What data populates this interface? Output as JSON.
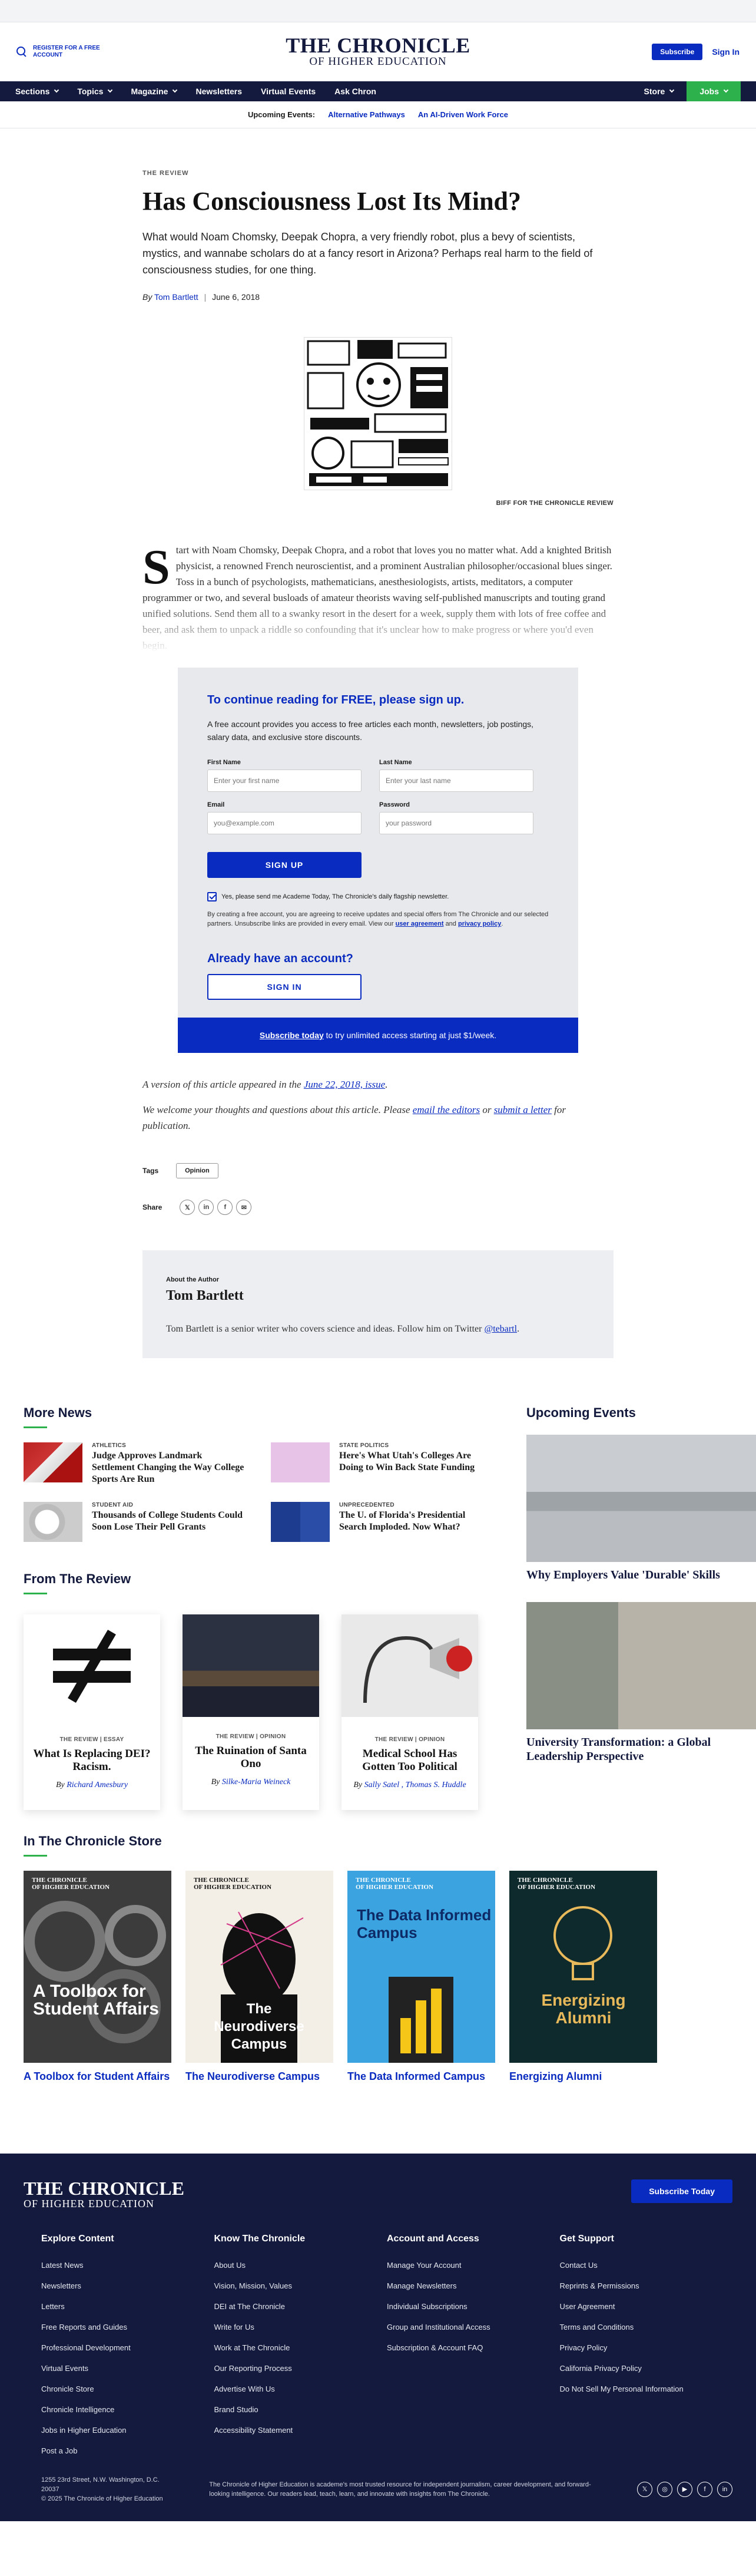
{
  "header": {
    "register": "REGISTER FOR A FREE ACCOUNT",
    "logo_line1": "THE CHRONICLE",
    "logo_line2": "OF HIGHER EDUCATION",
    "subscribe": "Subscribe",
    "signin": "Sign In"
  },
  "nav": {
    "left": [
      "Sections",
      "Topics",
      "Magazine",
      "Newsletters",
      "Virtual Events",
      "Ask Chron"
    ],
    "right": [
      "Store",
      "Jobs"
    ]
  },
  "upcoming": {
    "label": "Upcoming Events:",
    "links": [
      "Alternative Pathways",
      "An AI-Driven Work Force"
    ]
  },
  "article": {
    "kicker": "THE REVIEW",
    "title": "Has Consciousness Lost Its Mind?",
    "dek": "What would Noam Chomsky, Deepak Chopra, a very friendly robot, plus a bevy of scientists, mystics, and wannabe scholars do at a fancy resort in Arizona? Perhaps real harm to the field of consciousness studies, for one thing.",
    "by": "By",
    "author": "Tom Bartlett",
    "date": "June 6, 2018",
    "caption": "BIFF FOR THE CHRONICLE REVIEW",
    "dropcap": "S",
    "body": "tart with Noam Chomsky, Deepak Chopra, and a robot that loves you no matter what. Add a knighted British physicist, a renowned French neuroscientist, and a prominent Australian philosopher/occasional blues singer. Toss in a bunch of psychologists, mathematicians, anesthesiologists, artists, meditators, a computer programmer or two, and several busloads of amateur theorists waving self-published manuscripts and touting grand unified solutions. Send them all to a swanky resort in the desert for a week, supply them with lots of free coffee and beer, and ask them to unpack a riddle so confounding that it's unclear how to make progress or where you'd even begin."
  },
  "paywall": {
    "title": "To continue reading for FREE, please sign up.",
    "text": "A free account provides you access to free articles each month, newsletters, job postings, salary data, and exclusive store discounts.",
    "first_label": "First Name",
    "first_ph": "Enter your first name",
    "last_label": "Last Name",
    "last_ph": "Enter your last name",
    "email_label": "Email",
    "email_ph": "you@example.com",
    "password_label": "Password",
    "password_ph": "your password",
    "signup": "SIGN UP",
    "check_label": "Yes, please send me Academe Today, The Chronicle's daily flagship newsletter.",
    "legal_1": "By creating a free account, you are agreeing to receive updates and special offers from The Chronicle and our selected partners. Unsubscribe links are provided in every email. View our",
    "legal_link1": "user agreement",
    "legal_and": "and",
    "legal_link2": "privacy policy",
    "have_account": "Already have an account?",
    "signin": "SIGN IN",
    "bar_link": "Subscribe today",
    "bar_text": "to try unlimited access starting at just $1/week."
  },
  "after": {
    "version_1": "A version of this article appeared in the",
    "version_link": "June 22, 2018, issue",
    "welcome_1": "We welcome your thoughts and questions about this article. Please",
    "welcome_link1": "email the editors",
    "welcome_or": "or",
    "welcome_link2": "submit a letter",
    "welcome_2": "for publication.",
    "tags_label": "Tags",
    "tag": "Opinion",
    "share_label": "Share",
    "share_icons": [
      "x-icon",
      "linkedin-icon",
      "facebook-icon",
      "email-icon"
    ]
  },
  "author_box": {
    "kicker": "About the Author",
    "name": "Tom Bartlett",
    "bio": "Tom Bartlett is a senior writer who covers science and ideas. Follow him on Twitter",
    "handle": "@tebartl"
  },
  "more_news": {
    "title": "More News",
    "items": [
      {
        "category": "ATHLETICS",
        "headline": "Judge Approves Landmark Settlement Changing the Way College Sports Are Run"
      },
      {
        "category": "STATE POLITICS",
        "headline": "Here's What Utah's Colleges Are Doing to Win Back State Funding"
      },
      {
        "category": "STUDENT AID",
        "headline": "Thousands of College Students Could Soon Lose Their Pell Grants"
      },
      {
        "category": "UNPRECEDENTED",
        "headline": "The U. of Florida's Presidential Search Imploded. Now What?"
      }
    ]
  },
  "upcoming_events": {
    "title": "Upcoming Events",
    "items": [
      "Why Employers Value 'Durable' Skills",
      "University Transformation: a Global Leadership Perspective"
    ]
  },
  "review": {
    "title": "From The Review",
    "cards": [
      {
        "kicker": "THE REVIEW | ESSAY",
        "headline": "What Is Replacing DEI? Racism.",
        "by": "By",
        "authors": "Richard Amesbury"
      },
      {
        "kicker": "THE REVIEW | OPINION",
        "headline": "The Ruination of Santa Ono",
        "by": "By",
        "authors": "Silke-Maria Weineck"
      },
      {
        "kicker": "THE REVIEW | OPINION",
        "headline": "Medical School Has Gotten Too Political",
        "by": "By",
        "authors": "Sally Satel , Thomas S. Huddle"
      }
    ]
  },
  "store": {
    "title": "In The Chronicle Store",
    "book_logo_1": "THE CHRONICLE",
    "book_logo_2": "OF HIGHER EDUCATION",
    "items": [
      {
        "cover_title": "A Toolbox for Student Affairs",
        "title": "A Toolbox for Student Affairs"
      },
      {
        "cover_title": "The Neurodiverse Campus",
        "title": "The Neurodiverse Campus"
      },
      {
        "cover_title": "The Data Informed Campus",
        "title": "The Data Informed Campus"
      },
      {
        "cover_title": "Energizing Alumni",
        "title": "Energizing Alumni"
      }
    ]
  },
  "footer": {
    "logo_line1": "THE CHRONICLE",
    "logo_line2": "OF HIGHER EDUCATION",
    "subscribe": "Subscribe Today",
    "columns": [
      {
        "title": "Explore Content",
        "links": [
          "Latest News",
          "Newsletters",
          "Letters",
          "Free Reports and Guides",
          "Professional Development",
          "Virtual Events",
          "Chronicle Store",
          "Chronicle Intelligence",
          "Jobs in Higher Education",
          "Post a Job"
        ]
      },
      {
        "title": "Know The Chronicle",
        "links": [
          "About Us",
          "Vision, Mission, Values",
          "DEI at The Chronicle",
          "Write for Us",
          "Work at The Chronicle",
          "Our Reporting Process",
          "Advertise With Us",
          "Brand Studio",
          "Accessibility Statement"
        ]
      },
      {
        "title": "Account and Access",
        "links": [
          "Manage Your Account",
          "Manage Newsletters",
          "Individual Subscriptions",
          "Group and Institutional Access",
          "Subscription & Account FAQ"
        ]
      },
      {
        "title": "Get Support",
        "links": [
          "Contact Us",
          "Reprints & Permissions",
          "User Agreement",
          "Terms and Conditions",
          "Privacy Policy",
          "California Privacy Policy",
          "Do Not Sell My Personal Information"
        ]
      }
    ],
    "address": "1255 23rd Street, N.W. Washington, D.C. 20037",
    "copyright": "© 2025 The Chronicle of Higher Education",
    "description": "The Chronicle of Higher Education is academe's most trusted resource for independent journalism, career development, and forward-looking intelligence. Our readers lead, teach, learn, and innovate with insights from The Chronicle.",
    "social": [
      "x-icon",
      "instagram-icon",
      "youtube-icon",
      "facebook-icon",
      "linkedin-icon"
    ]
  },
  "colors": {
    "brand_blue": "#0a2bbf",
    "navy": "#141a3d",
    "green": "#2db14d"
  }
}
